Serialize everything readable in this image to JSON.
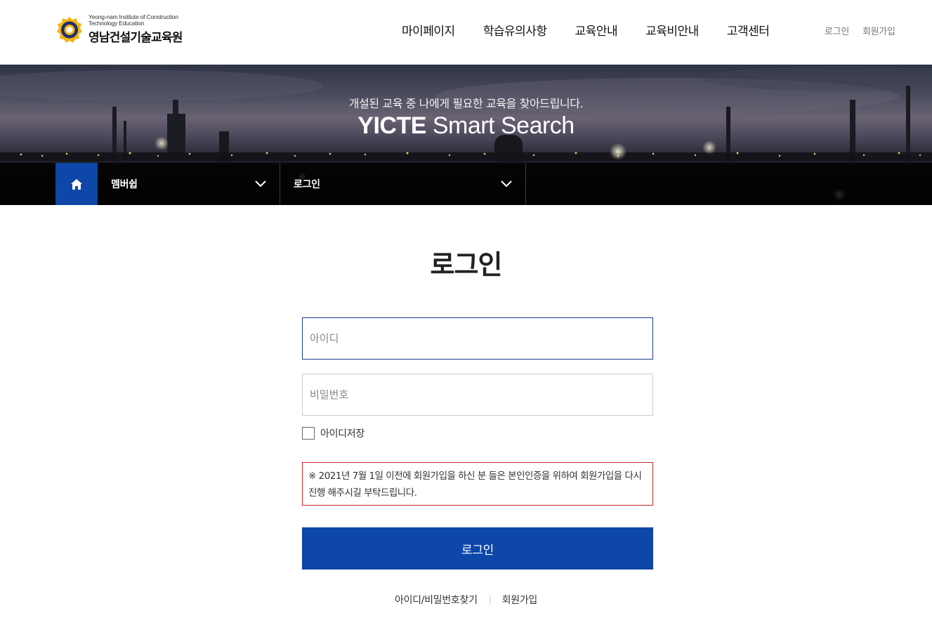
{
  "header": {
    "logo": {
      "en": "Yeong-nam Institute of Construction Technology Education",
      "ko": "영남건설기술교육원"
    },
    "gnb": [
      {
        "label": "마이페이지"
      },
      {
        "label": "학습유의사항"
      },
      {
        "label": "교육안내"
      },
      {
        "label": "교육비안내"
      },
      {
        "label": "고객센터"
      }
    ],
    "util": [
      {
        "label": "로그인"
      },
      {
        "label": "회원가입"
      }
    ]
  },
  "banner": {
    "subtitle": "개설된 교육 중 나에게 필요한 교육을 찾아드립니다.",
    "title_bold": "YICTE",
    "title_rest": " Smart Search"
  },
  "location": {
    "home_icon": "home-icon",
    "depth1": "멤버쉽",
    "depth2": "로그인"
  },
  "login": {
    "title": "로그인",
    "id_placeholder": "아이디",
    "pw_placeholder": "비밀번호",
    "save_id_label": "아이디저장",
    "save_id_checked": false,
    "notice": "※ 2021년 7월 1일 이전에 회원가입을 하신 분 들은 본인인증을 위하여 회원가입을 다시 진행 해주시길 부탁드립니다.",
    "submit_label": "로그인",
    "links": [
      {
        "label": "아이디/비밀번호찾기"
      },
      {
        "label": "회원가입"
      }
    ]
  },
  "colors": {
    "primary": "#0d47a8",
    "notice_border": "#c62828",
    "focus_border": "#1b3d8a"
  }
}
